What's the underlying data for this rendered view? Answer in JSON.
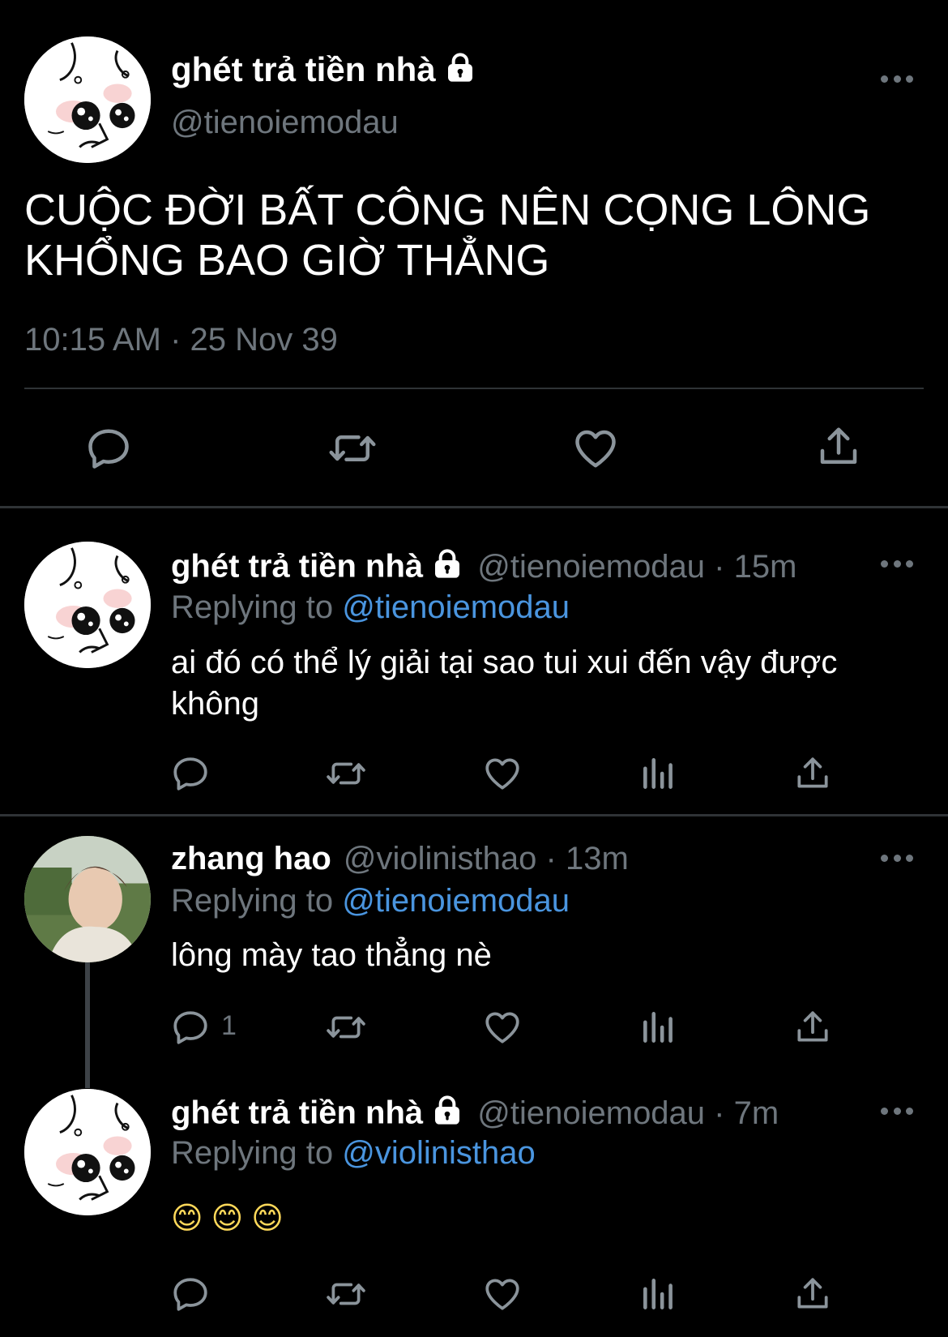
{
  "main_tweet": {
    "display_name": "ghét trả tiền nhà",
    "handle": "@tienoiemodau",
    "text_line1": "CUỘC ĐỜI BẤT CÔNG NÊN CỌNG LÔNG",
    "text_line2": "KHỔNG BAO GIỜ THẲNG",
    "timestamp": "10:15 AM · 25 Nov 39",
    "icons": [
      "reply-icon",
      "retweet-icon",
      "like-icon",
      "share-icon"
    ]
  },
  "replies": [
    {
      "display_name": "ghét trả tiền nhà",
      "handle_time": "@tienoiemodau · 15m",
      "replying_label": "Replying to",
      "replying_to": "@tienoiemodau",
      "text_line1": "ai đó có thể lý giải tại sao tui xui đến vậy được",
      "text_line2": "không",
      "reply_count": ""
    },
    {
      "display_name": "zhang hao",
      "handle_time": "@violinisthao · 13m",
      "replying_label": "Replying to",
      "replying_to": "@tienoiemodau",
      "text_line1": "lông mày tao thẳng nè",
      "reply_count": "1"
    },
    {
      "display_name": "ghét trả tiền nhà",
      "handle_time": "@tienoiemodau · 7m",
      "replying_label": "Replying to",
      "replying_to": "@violinisthao",
      "text_line1": "😊😊😊",
      "reply_count": ""
    }
  ],
  "colors": {
    "background": "#000000",
    "text": "#ffffff",
    "muted": "#6e767d",
    "link": "#4a95df"
  }
}
